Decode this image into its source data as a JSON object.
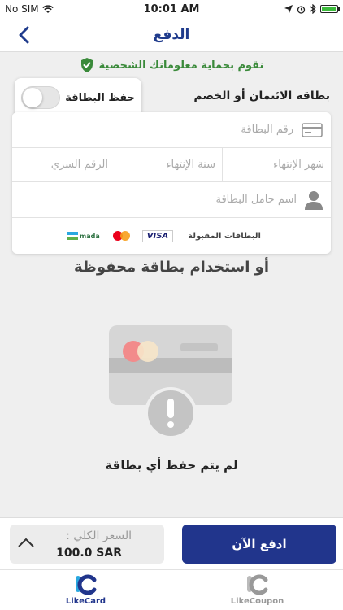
{
  "status_bar": {
    "carrier": "No SIM",
    "time": "10:01 AM"
  },
  "nav": {
    "title": "الدفع"
  },
  "protection_note": "نقوم بحماية معلوماتك الشخصية",
  "card_section": {
    "title": "بطاقة الائتمان أو الخصم",
    "save_card_label": "حفظ البطاقة",
    "card_number_placeholder": "رقم البطاقة",
    "expiry_month_placeholder": "شهر الإنتهاء",
    "expiry_year_placeholder": "سنة الإنتهاء",
    "cvv_placeholder": "الرقم السري",
    "holder_name_placeholder": "اسم حامل البطاقة",
    "accepted_cards_label": "البطاقات المقبولة",
    "accepted_cards": [
      "VISA",
      "Mastercard",
      "mada"
    ]
  },
  "saved_cards": {
    "title": "أو استخدام بطاقة محفوظة",
    "empty_message": "لم يتم حفظ أي بطاقة"
  },
  "checkout": {
    "total_label": "السعر الكلي :",
    "total_value": "100.0 SAR",
    "pay_button": "ادفع الآن"
  },
  "tabs": [
    {
      "label": "LikeCard"
    },
    {
      "label": "LikeCoupon"
    }
  ],
  "colors": {
    "primary": "#21358c",
    "secure_green": "#3a8a3a"
  }
}
